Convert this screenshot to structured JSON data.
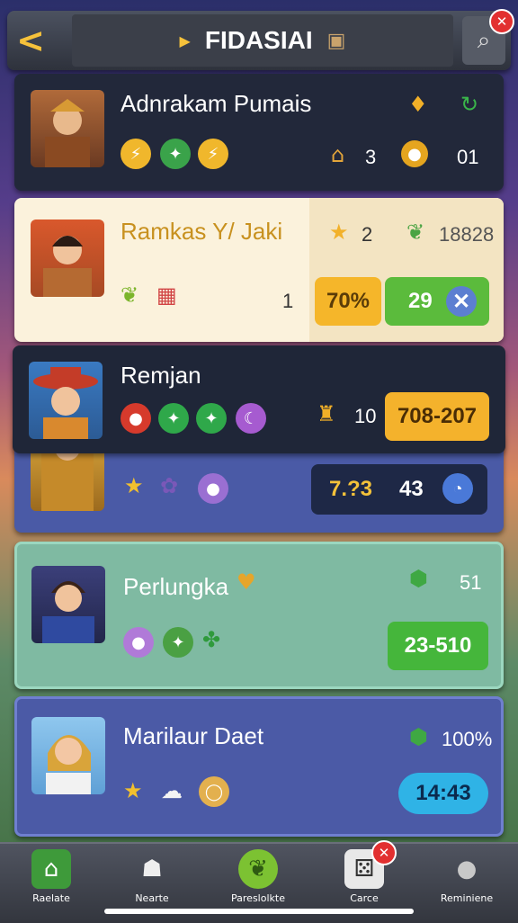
{
  "header": {
    "title": "FIDASIAI",
    "back_glyph": "<",
    "colors": {
      "accent": "#f6c23b"
    }
  },
  "players": [
    {
      "name": "Adnrakam Pumais",
      "stat1": "3",
      "stat2": "01"
    },
    {
      "name": "Ramkas Y/ Jaki",
      "stat1": "2",
      "stat2": "18828",
      "rank": "1",
      "percent": "70%",
      "score": "29"
    },
    {
      "name": "Remjan",
      "stat1": "10",
      "range": "708-207"
    },
    {
      "extra": "7.?3",
      "score": "43"
    },
    {
      "name": "Perlungka",
      "stat1": "51",
      "range": "23-510"
    },
    {
      "name": "Marilaur Daet",
      "stat1": "100%",
      "time": "14:43"
    }
  ],
  "nav": [
    {
      "label": "Raelate",
      "icon": "home-icon",
      "color": "#3e9a3a"
    },
    {
      "label": "Nearte",
      "icon": "friends-icon",
      "color": "#d8d8d8"
    },
    {
      "label": "Pareslolkte",
      "icon": "leaf-icon",
      "color": "#7cc232"
    },
    {
      "label": "Carce",
      "icon": "dice-icon",
      "color": "#e8e8e8"
    },
    {
      "label": "Reminiene",
      "icon": "profile-icon",
      "color": "#c8c8c8"
    }
  ]
}
